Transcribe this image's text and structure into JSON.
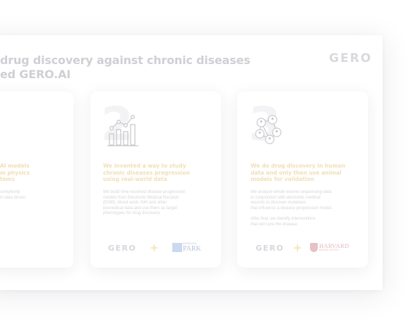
{
  "slide": {
    "title_line1": "drug discovery against chronic diseases",
    "title_line2": "ed GERO.AI",
    "logo": "GERO"
  },
  "cards": [
    {
      "heading": [
        "AI models",
        "m physics",
        "tems"
      ],
      "body": [
        "complexity",
        "in data driven."
      ]
    },
    {
      "number": "2",
      "icon": "bar-chart-icon",
      "heading": [
        "We invented a way to study",
        "chronic diseases progression",
        "using real-world data"
      ],
      "body": [
        "We build time-resolved disease progression",
        "models from Electronic Medical Records",
        "(EMR), blood work, NIH and other",
        "biomedical data and use them as target",
        "phenotypes for drug discovery."
      ],
      "footer": {
        "logo": "GERO",
        "plus": "+",
        "partner_small": "BIOMEDICAL",
        "partner_name": "PARK"
      }
    },
    {
      "number": "3",
      "icon": "people-network-icon",
      "heading": [
        "We do drug discovery in human",
        "data and only then use animal",
        "models for validation"
      ],
      "body": [
        "We analyze whole-exome sequencing data",
        "in conjunction with electronic medical",
        "records to discover mutations",
        "that influence a disease progression model.",
        "",
        "After that, we identify interventions",
        "that will cure the disease."
      ],
      "footer": {
        "logo": "GERO",
        "plus": "+",
        "partner_name": "HARVARD",
        "partner_sub": "MEDICAL SCHOOL"
      }
    }
  ],
  "colors": {
    "heading": "#f1dfb7",
    "body": "#d5d6da",
    "logo": "#d8d9dd",
    "accent_plus": "#f3e3b8"
  }
}
